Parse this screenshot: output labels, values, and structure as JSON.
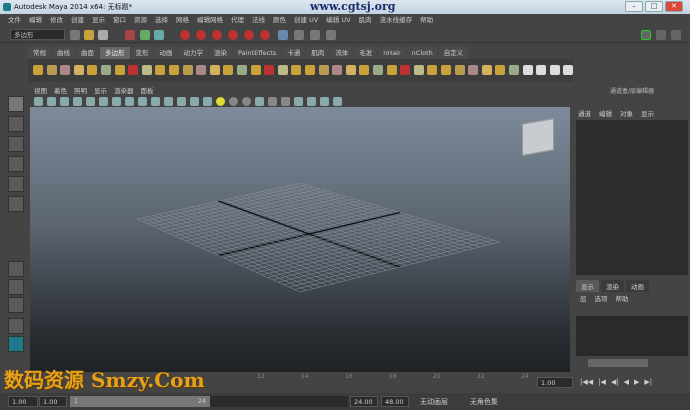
{
  "window": {
    "title": "Autodesk Maya 2014 x64: 无标题*",
    "watermark_top": "www.cgtsj.org"
  },
  "menus": [
    "文件",
    "编辑",
    "修改",
    "创建",
    "显示",
    "窗口",
    "资源",
    "选择",
    "网格",
    "编辑网格",
    "代理",
    "法线",
    "颜色",
    "创建 UV",
    "编辑 UV",
    "肌肉",
    "流水线缓存",
    "帮助"
  ],
  "status": {
    "mode_select": "多边形"
  },
  "shelf_tabs": [
    "常规",
    "曲线",
    "曲面",
    "多边形",
    "变形",
    "动画",
    "动力学",
    "渲染",
    "PaintEffects",
    "卡通",
    "肌肉",
    "流体",
    "毛发",
    "nHair",
    "nCloth",
    "自定义"
  ],
  "shelf_active": 3,
  "panel_menu": [
    "视图",
    "着色",
    "照明",
    "显示",
    "渲染器",
    "面板"
  ],
  "right_panel": {
    "title": "通道盒/层编辑器",
    "menu": [
      "通道",
      "编辑",
      "对象",
      "显示"
    ],
    "layer_tabs": [
      "显示",
      "渲染",
      "动画"
    ],
    "layer_menu": [
      "层",
      "选项",
      "帮助"
    ]
  },
  "timeline": {
    "ticks": [
      "12",
      "14",
      "16",
      "18",
      "20",
      "22",
      "24"
    ],
    "current": "1.00"
  },
  "range": {
    "start": "1.00",
    "inner_start": "1.00",
    "slider_start": "1",
    "slider_end": "24",
    "end": "24.00",
    "outer_end": "48.00",
    "anim_layer": "无动画层",
    "char_set": "无角色集"
  },
  "watermark_bottom": "数码资源 Smzy.Com",
  "colors": {
    "viewport_top": "#7e8b9b",
    "viewport_bottom": "#202326",
    "accent": "#e7a11b"
  }
}
